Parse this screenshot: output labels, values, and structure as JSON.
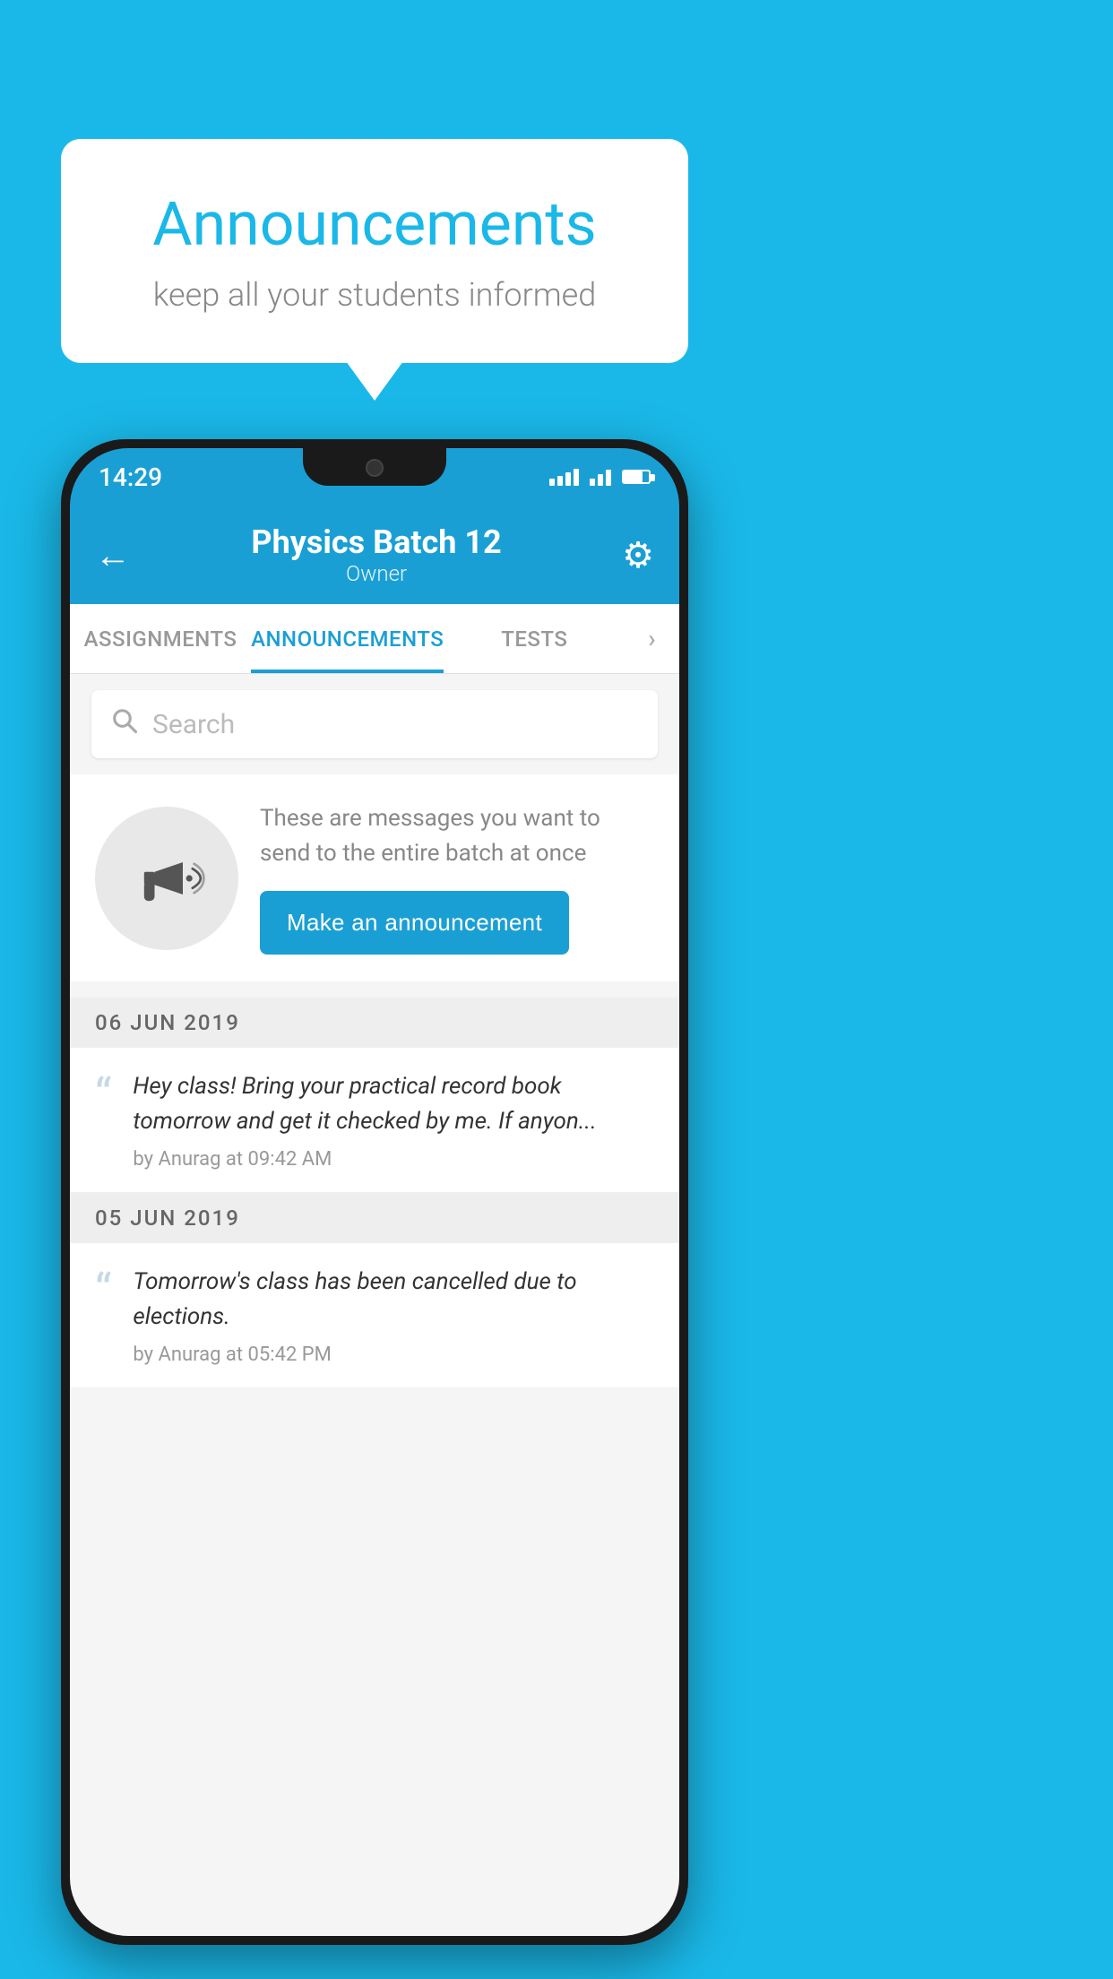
{
  "background_color": "#1ab8e8",
  "speech_bubble": {
    "title": "Announcements",
    "subtitle": "keep all your students informed"
  },
  "phone": {
    "status_bar": {
      "time": "14:29"
    },
    "header": {
      "title": "Physics Batch 12",
      "subtitle": "Owner",
      "back_icon": "←",
      "settings_icon": "⚙"
    },
    "tabs": [
      {
        "label": "ASSIGNMENTS",
        "active": false
      },
      {
        "label": "ANNOUNCEMENTS",
        "active": true
      },
      {
        "label": "TESTS",
        "active": false
      },
      {
        "label": "•••",
        "active": false
      }
    ],
    "search": {
      "placeholder": "Search"
    },
    "announcement_intro": {
      "description_text": "These are messages you want to send to the entire batch at once",
      "button_label": "Make an announcement"
    },
    "announcements": [
      {
        "date": "06  JUN  2019",
        "text": "Hey class! Bring your practical record book tomorrow and get it checked by me. If anyon...",
        "author": "by Anurag at 09:42 AM"
      },
      {
        "date": "05  JUN  2019",
        "text": "Tomorrow's class has been cancelled due to elections.",
        "author": "by Anurag at 05:42 PM"
      }
    ]
  }
}
